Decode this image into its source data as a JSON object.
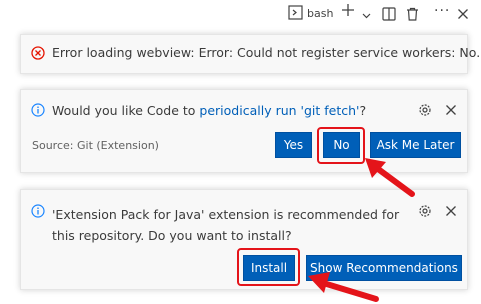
{
  "terminal_bar": {
    "shell_label": "bash",
    "icons": [
      "terminal-icon",
      "plus-icon",
      "chevron-down-icon",
      "split-icon",
      "trash-icon",
      "more-icon",
      "close-icon"
    ]
  },
  "notifications": [
    {
      "type": "error",
      "message": "Error loading webview: Error: Could not register service workers: No..."
    },
    {
      "type": "info",
      "message_prefix": "Would you like Code to ",
      "message_link": "periodically run 'git fetch'",
      "message_suffix": "?",
      "source": "Source: Git (Extension)",
      "buttons": [
        "Yes",
        "No",
        "Ask Me Later"
      ],
      "highlighted_button": "No"
    },
    {
      "type": "info",
      "message": "'Extension Pack for Java' extension is recommended for this repository. Do you want to install?",
      "buttons": [
        "Install",
        "Show Recommendations"
      ],
      "highlighted_button": "Install"
    }
  ],
  "colors": {
    "button_bg": "#005fb8",
    "link": "#005fb8",
    "error": "#e51400",
    "annotation": "#e4141a"
  }
}
